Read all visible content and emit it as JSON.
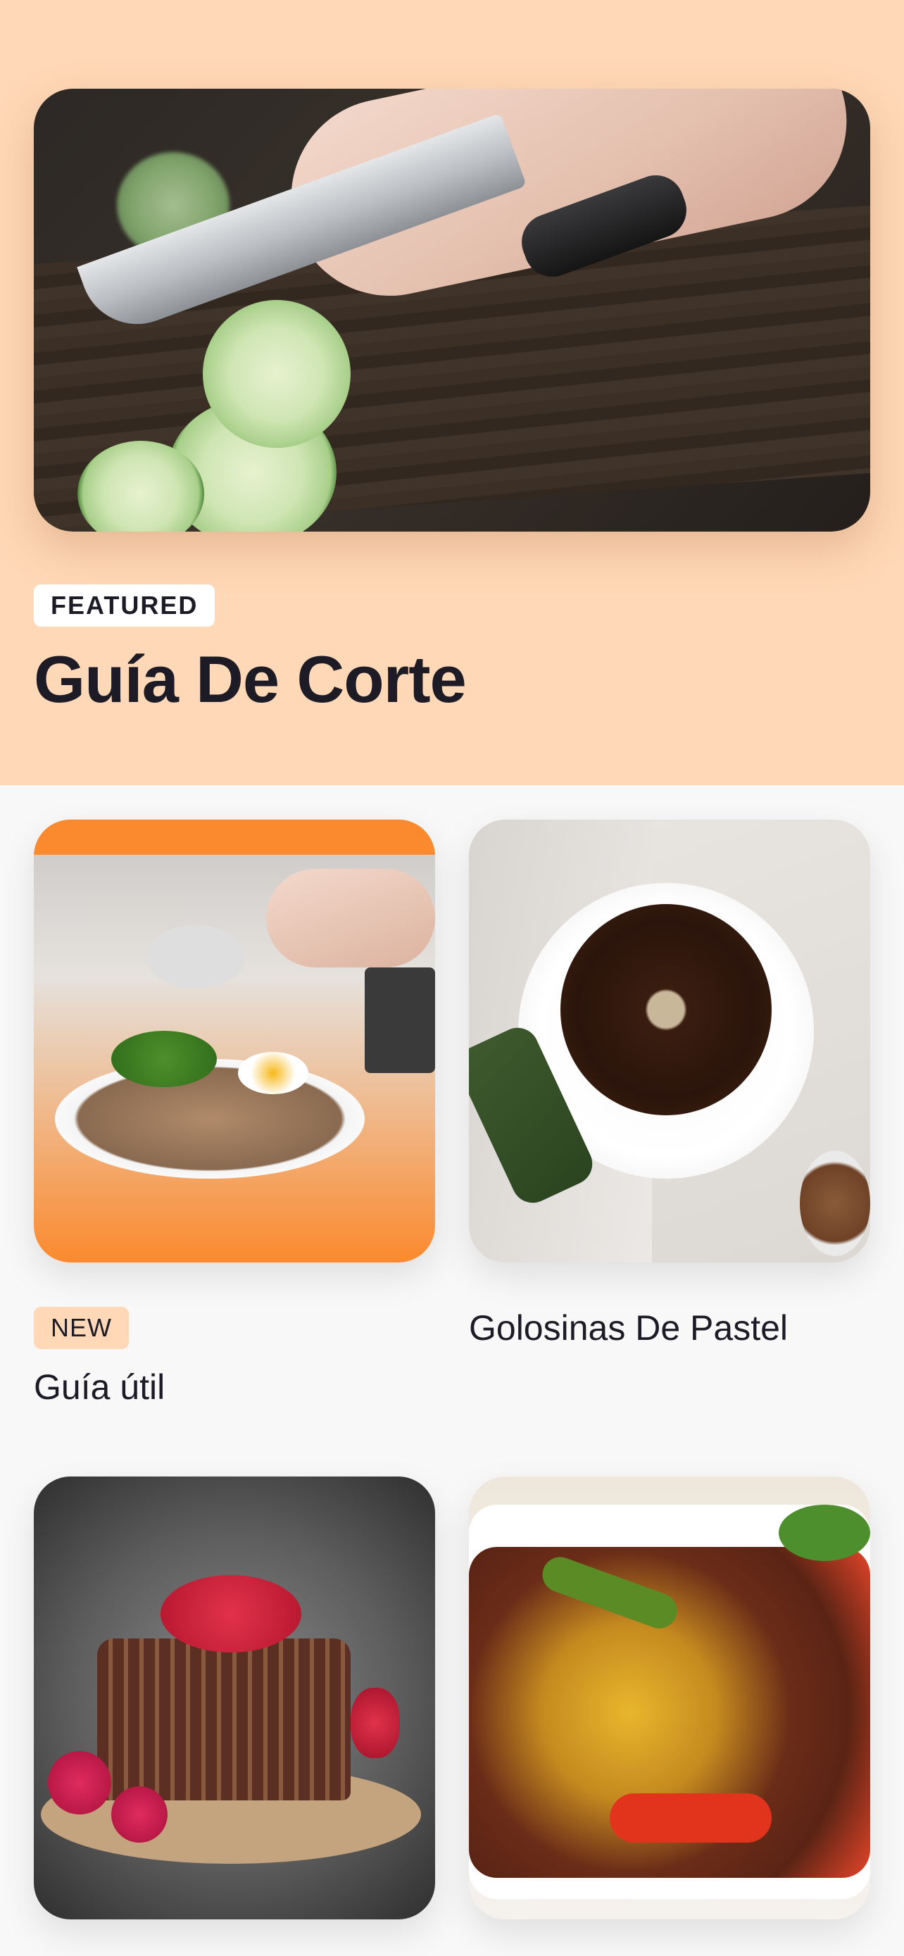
{
  "featured": {
    "badge": "FEATURED",
    "title": "Guía De Corte",
    "image_icon": "cucumber-cutting-photo",
    "accent_color": "#ffd8b7"
  },
  "cards": [
    {
      "label": "Guía útil",
      "badge": "NEW",
      "image_icon": "buckwheat-plate-photo"
    },
    {
      "label": "Golosinas De Pastel",
      "badge": "",
      "image_icon": "bundt-cake-photo"
    },
    {
      "label": "",
      "badge": "",
      "image_icon": "chocolate-cake-slice-photo"
    },
    {
      "label": "",
      "badge": "",
      "image_icon": "sweet-sour-pork-photo"
    }
  ],
  "colors": {
    "background": "#f9f8f8",
    "hero_background": "#ffd8b7",
    "text": "#1c1b26",
    "badge_new_background": "#ffd8b7"
  }
}
